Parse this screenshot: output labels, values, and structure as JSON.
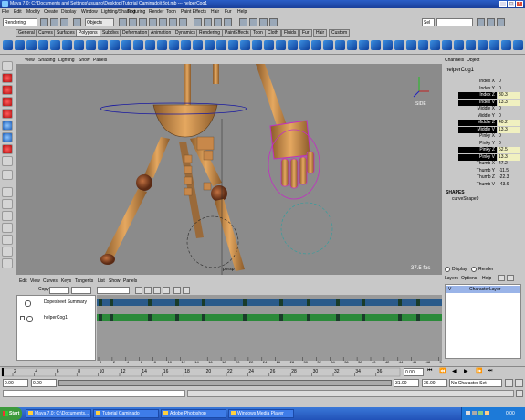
{
  "window": {
    "title": "Maya 7.0: C:\\Documents and Settings\\usuario\\Desktop\\Tutorial Caminado\\tBot.mb  ---  helperCog1"
  },
  "menubar": [
    "File",
    "Edit",
    "Modify",
    "Create",
    "Display",
    "Window",
    "Lighting/Shading",
    "Texturing",
    "Render",
    "Toon",
    "Paint Effects",
    "Hair",
    "Fur",
    "Help"
  ],
  "statusline": {
    "mode": "Rendering",
    "objects_label": "Objects",
    "selection_label": "Sel"
  },
  "shelf_tabs": [
    "General",
    "Curves",
    "Surfaces",
    "Polygons",
    "Subdivs",
    "Deformation",
    "Animation",
    "Dynamics",
    "Rendering",
    "PaintEffects",
    "Toon",
    "Cloth",
    "Fluids",
    "Fur",
    "Hair",
    "Custom"
  ],
  "shelf_selected": "Polygons",
  "viewport": {
    "menu": [
      "View",
      "Shading",
      "Lighting",
      "Show",
      "Panels"
    ],
    "fps": "37.5 fps",
    "axis_label": "persp",
    "cube_label": "SIDE"
  },
  "channel_box": {
    "header": [
      "Channels",
      "Object"
    ],
    "node": "helperCog1",
    "channels": [
      {
        "name": "Index X",
        "value": "0",
        "hi": false
      },
      {
        "name": "Index Y",
        "value": "0",
        "hi": false
      },
      {
        "name": "Index Z",
        "value": "30.3",
        "hi": true
      },
      {
        "name": "Index V",
        "value": "13.3",
        "hi": true
      },
      {
        "name": "Middle X",
        "value": "0",
        "hi": false
      },
      {
        "name": "Middle Y",
        "value": "0",
        "hi": false
      },
      {
        "name": "Middle Z",
        "value": "40.2",
        "hi": true
      },
      {
        "name": "Middle V",
        "value": "13.3",
        "hi": true
      },
      {
        "name": "Pinky X",
        "value": "0",
        "hi": false
      },
      {
        "name": "Pinky Y",
        "value": "0",
        "hi": false
      },
      {
        "name": "Pinky Z",
        "value": "52.5",
        "hi": true
      },
      {
        "name": "Pinky V",
        "value": "13.3",
        "hi": true
      },
      {
        "name": "Thumb X",
        "value": "47.2",
        "hi": false
      },
      {
        "name": "Thumb Y",
        "value": "-11.5",
        "hi": false
      },
      {
        "name": "Thumb Z",
        "value": "-22.3",
        "hi": false
      },
      {
        "name": "Thumb V",
        "value": "-43.6",
        "hi": false
      }
    ],
    "shapes_title": "SHAPES",
    "shape": "curveShape9"
  },
  "layers": {
    "tabs": [
      "Display",
      "Render"
    ],
    "menu": [
      "Layers",
      "Options",
      "Help"
    ],
    "layer_name": "CharacterLayer"
  },
  "dopesheet": {
    "menu": [
      "Edit",
      "View",
      "Curves",
      "Keys",
      "Tangents",
      "List",
      "Show",
      "Panels"
    ],
    "field_label": "Copy",
    "rows": [
      "Dopesheet Summary",
      "helperCog1"
    ],
    "ruler": [
      "0",
      "2",
      "4",
      "6",
      "8",
      "10",
      "12",
      "14",
      "16",
      "18",
      "20",
      "22",
      "24",
      "26",
      "28",
      "30",
      "32",
      "34",
      "36",
      "38",
      "40",
      "42",
      "44",
      "46",
      "48",
      "50"
    ]
  },
  "timeline": {
    "ticks": [
      "2",
      "4",
      "6",
      "8",
      "10",
      "12",
      "14",
      "16",
      "18",
      "20",
      "22",
      "24",
      "26",
      "28",
      "30",
      "32",
      "34",
      "36"
    ],
    "current": "0.00"
  },
  "range": {
    "start": "0.00",
    "start2": "0.00",
    "end1": "31.00",
    "end2": "36.00",
    "character": "No Character Set"
  },
  "taskbar": {
    "start": "Start",
    "tasks": [
      "Maya 7.0: C:\\Documents...",
      "Tutorial Caminado",
      "Adobe Photoshop",
      "Windows Media Player"
    ],
    "clock": "0:00"
  },
  "colors": {
    "accent": "#2a5ec8",
    "key": "#1a3c2a",
    "summary_track": "#2a5a8a",
    "object_track": "#2b8a3a"
  }
}
